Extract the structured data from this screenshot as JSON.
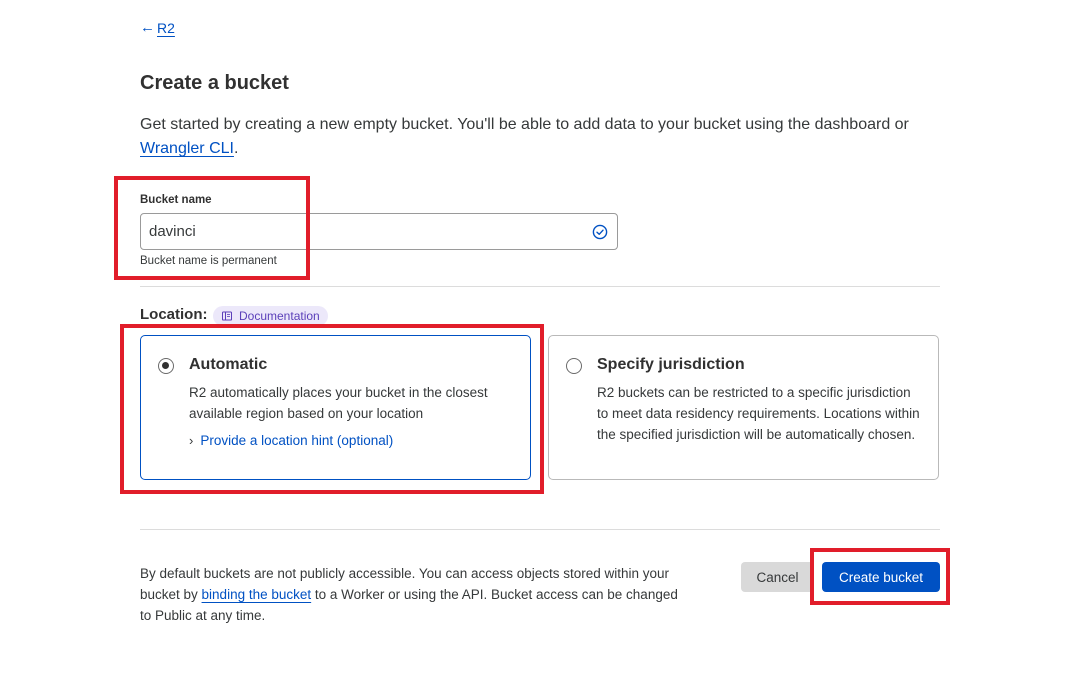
{
  "nav": {
    "back_arrow": "←",
    "back_label": "R2"
  },
  "page": {
    "title": "Create a bucket",
    "intro_text": "Get started by creating a new empty bucket. You'll be able to add data to your bucket using the dashboard or ",
    "intro_link": "Wrangler CLI",
    "intro_end": "."
  },
  "bucket_name": {
    "label": "Bucket name",
    "value": "davinci",
    "hint": "Bucket name is permanent",
    "status_icon": "check-circle-icon"
  },
  "location": {
    "label": "Location:",
    "doc_badge": "Documentation",
    "doc_icon": "book-icon",
    "options": [
      {
        "title": "Automatic",
        "description": "R2 automatically places your bucket in the closest available region based on your location",
        "link": "Provide a location hint (optional)",
        "link_icon": "chevron-right-icon",
        "selected": true
      },
      {
        "title": "Specify jurisdiction",
        "description": "R2 buckets can be restricted to a specific jurisdiction to meet data residency requirements. Locations within the specified jurisdiction will be automatically chosen.",
        "selected": false
      }
    ]
  },
  "footer": {
    "text_before": "By default buckets are not publicly accessible. You can access objects stored within your bucket by ",
    "link": "binding the bucket",
    "text_after": " to a Worker or using the API. Bucket access can be changed to Public at any time.",
    "cancel_label": "Cancel",
    "create_label": "Create bucket"
  },
  "colors": {
    "accent": "#0051c3",
    "annotation": "#e11d2a",
    "badge_bg": "#ece8fa",
    "badge_text": "#5b3fb9"
  }
}
